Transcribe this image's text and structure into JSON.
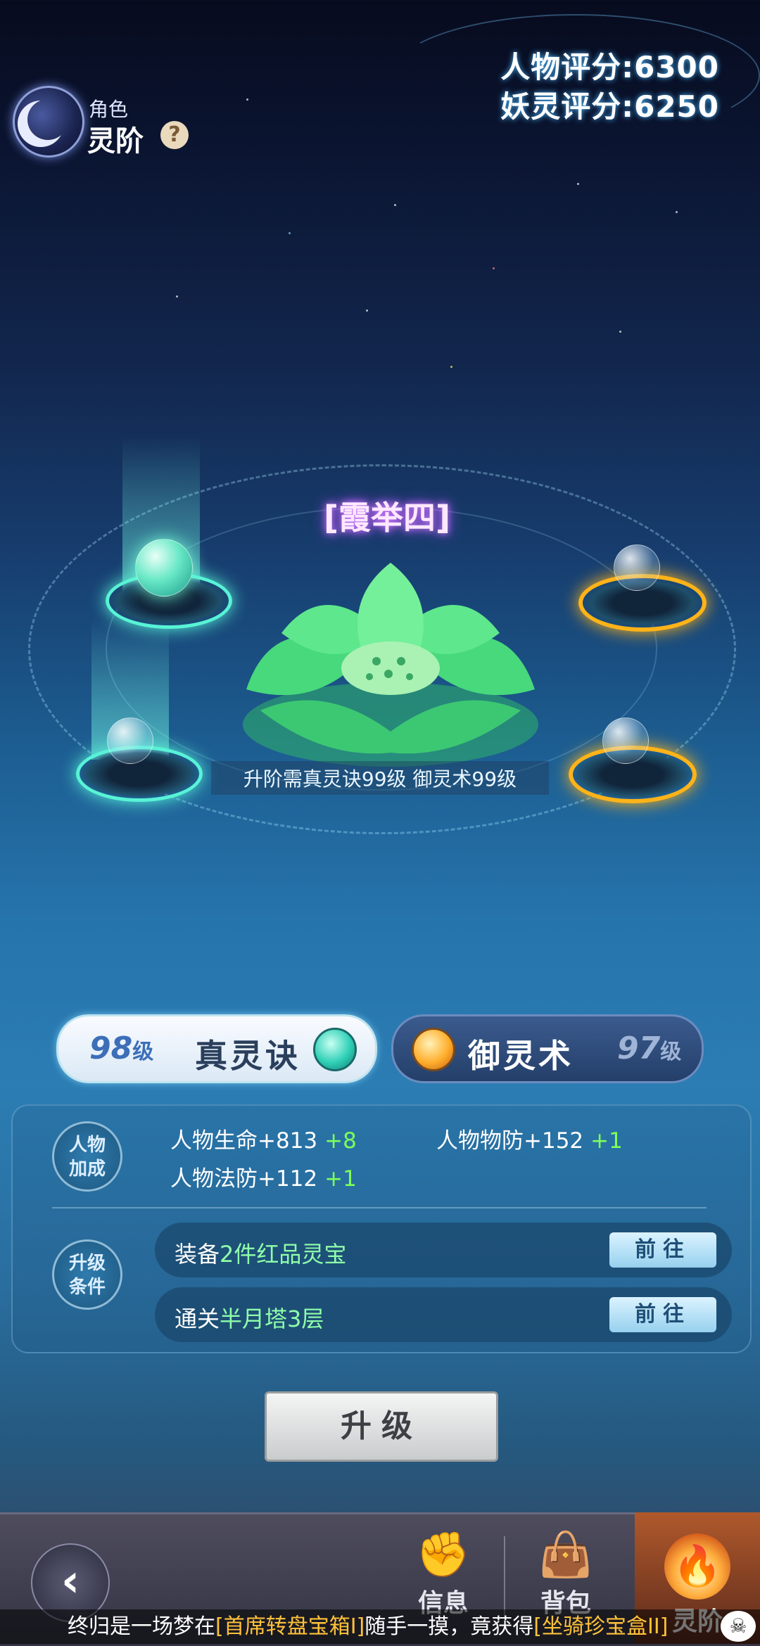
{
  "header": {
    "subtitle": "角色",
    "title": "灵阶",
    "help_icon": "?",
    "score_person_label": "人物评分",
    "score_person_value": "6300",
    "score_spirit_label": "妖灵评分",
    "score_spirit_value": "6250"
  },
  "stage": {
    "name": "[霞举四]",
    "requirement": "升阶需真灵诀99级 御灵术99级"
  },
  "tabs": {
    "left": {
      "level_num": "98",
      "level_unit": "级",
      "name": "真灵诀"
    },
    "right": {
      "level_num": "97",
      "level_unit": "级",
      "name": "御灵术"
    }
  },
  "bonus": {
    "badge": "人物加成",
    "badge_line1": "人物",
    "badge_line2": "加成",
    "stats": [
      {
        "label": "人物生命+813",
        "inc": "+8"
      },
      {
        "label": "人物物防+152",
        "inc": "+1"
      },
      {
        "label": "人物法防+112",
        "inc": "+1"
      }
    ]
  },
  "conditions": {
    "badge_line1": "升级",
    "badge_line2": "条件",
    "items": [
      {
        "prefix": "装备",
        "highlight": "2件红品灵宝",
        "button": "前往"
      },
      {
        "prefix": "通关",
        "highlight": "半月塔3层",
        "button": "前往"
      }
    ]
  },
  "upgrade_button": "升级",
  "bottom_nav": {
    "back": "‹",
    "items": [
      {
        "label": "信息",
        "icon": "fist-icon"
      },
      {
        "label": "背包",
        "icon": "bag-icon"
      },
      {
        "label": "灵阶",
        "icon": "flame-icon"
      }
    ]
  },
  "ticker": {
    "part1": "终归是一场梦在",
    "part2": "[首席转盘宝箱I]",
    "part3": "随手一摸，竟获得",
    "part4": "[坐骑珍宝盒II]"
  },
  "colors": {
    "accent_green": "#58f3d6",
    "accent_gold": "#ffb319",
    "increase_green": "#7dff5a"
  }
}
